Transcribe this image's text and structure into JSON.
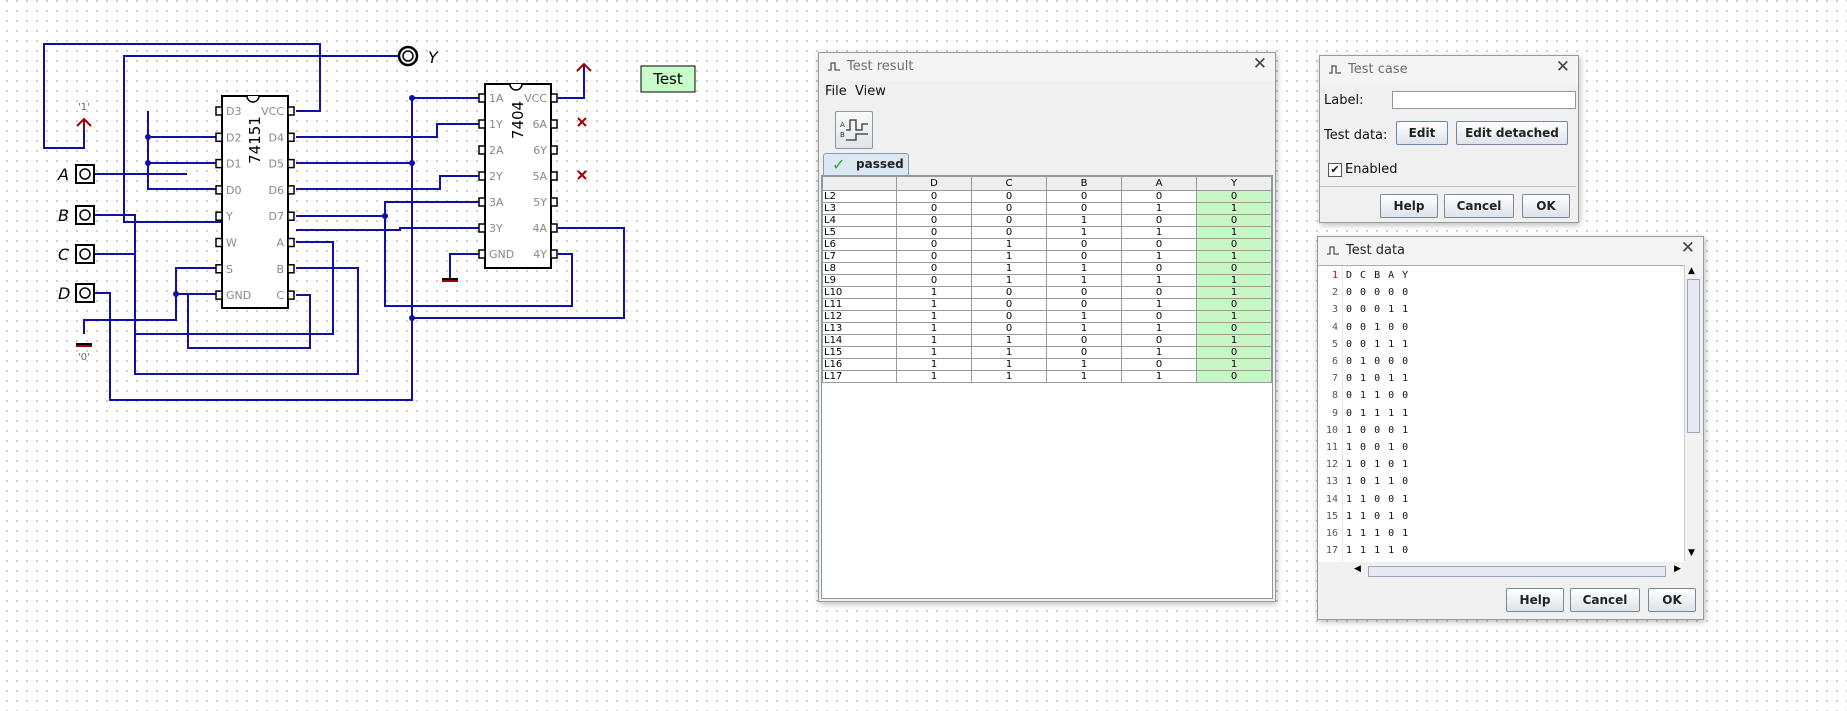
{
  "circuit": {
    "chip1": {
      "name": "74151",
      "left_pins": [
        "D3",
        "D2",
        "D1",
        "D0",
        "Y",
        "W",
        "S",
        "GND"
      ],
      "right_pins": [
        "VCC",
        "D4",
        "D5",
        "D6",
        "D7",
        "A",
        "B",
        "C"
      ]
    },
    "chip2": {
      "name": "7404",
      "left_pins": [
        "1A",
        "1Y",
        "2A",
        "2Y",
        "3A",
        "3Y",
        "GND"
      ],
      "right_pins": [
        "VCC",
        "6A",
        "6Y",
        "5A",
        "5Y",
        "4A",
        "4Y"
      ]
    },
    "inputs": [
      "A",
      "B",
      "C",
      "D"
    ],
    "output_label": "Y",
    "const_high": "'1'",
    "const_low": "'0'",
    "test_label": "Test",
    "colors": {
      "wire": "#1010a8",
      "test_bg": "#c8fcc8",
      "passed_bg": "#c7f7c4"
    }
  },
  "test_result": {
    "title": "Test result",
    "menu": [
      "File",
      "View"
    ],
    "tab_label": "passed",
    "columns": [
      "",
      "D",
      "C",
      "B",
      "A",
      "Y"
    ],
    "rows": [
      [
        "L2",
        "0",
        "0",
        "0",
        "0",
        "0"
      ],
      [
        "L3",
        "0",
        "0",
        "0",
        "1",
        "1"
      ],
      [
        "L4",
        "0",
        "0",
        "1",
        "0",
        "0"
      ],
      [
        "L5",
        "0",
        "0",
        "1",
        "1",
        "1"
      ],
      [
        "L6",
        "0",
        "1",
        "0",
        "0",
        "0"
      ],
      [
        "L7",
        "0",
        "1",
        "0",
        "1",
        "1"
      ],
      [
        "L8",
        "0",
        "1",
        "1",
        "0",
        "0"
      ],
      [
        "L9",
        "0",
        "1",
        "1",
        "1",
        "1"
      ],
      [
        "L10",
        "1",
        "0",
        "0",
        "0",
        "1"
      ],
      [
        "L11",
        "1",
        "0",
        "0",
        "1",
        "0"
      ],
      [
        "L12",
        "1",
        "0",
        "1",
        "0",
        "1"
      ],
      [
        "L13",
        "1",
        "0",
        "1",
        "1",
        "0"
      ],
      [
        "L14",
        "1",
        "1",
        "0",
        "0",
        "1"
      ],
      [
        "L15",
        "1",
        "1",
        "0",
        "1",
        "0"
      ],
      [
        "L16",
        "1",
        "1",
        "1",
        "0",
        "1"
      ],
      [
        "L17",
        "1",
        "1",
        "1",
        "1",
        "0"
      ]
    ]
  },
  "test_case": {
    "title": "Test case",
    "label_text": "Label:",
    "label_value": "",
    "test_data_text": "Test data:",
    "edit_button": "Edit",
    "edit_detached_button": "Edit detached",
    "enabled_text": "Enabled",
    "enabled_checked": true,
    "help_button": "Help",
    "cancel_button": "Cancel",
    "ok_button": "OK"
  },
  "test_data": {
    "title": "Test data",
    "lines": [
      "D C B A Y",
      "0 0 0 0 0",
      "0 0 0 1 1",
      "0 0 1 0 0",
      "0 0 1 1 1",
      "0 1 0 0 0",
      "0 1 0 1 1",
      "0 1 1 0 0",
      "0 1 1 1 1",
      "1 0 0 0 1",
      "1 0 0 1 0",
      "1 0 1 0 1",
      "1 0 1 1 0",
      "1 1 0 0 1",
      "1 1 0 1 0",
      "1 1 1 0 1",
      "1 1 1 1 0"
    ],
    "help_button": "Help",
    "cancel_button": "Cancel",
    "ok_button": "OK"
  }
}
